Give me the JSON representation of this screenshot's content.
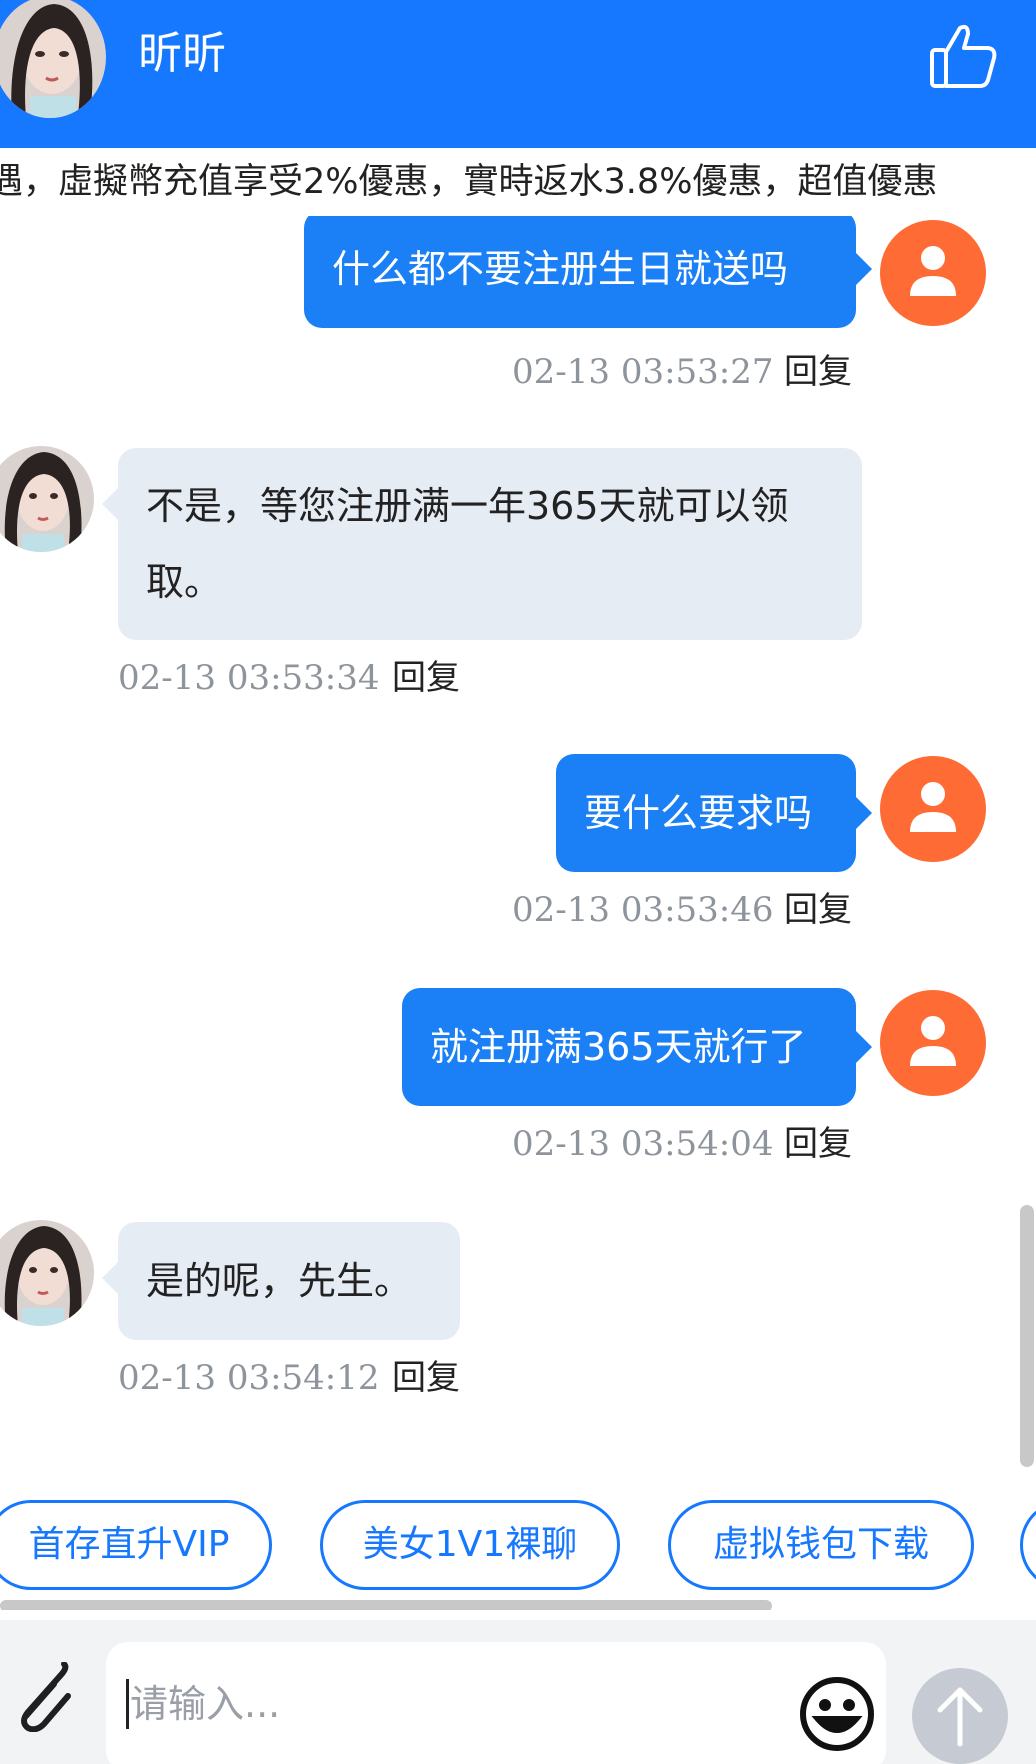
{
  "header": {
    "title": "昕昕"
  },
  "marquee": {
    "text": "遇，虛擬幣充值享受2%優惠，實時返水3.8%優惠，超值優惠"
  },
  "messages": [
    {
      "sender": "user",
      "text": "什么都不要注册生日就送吗",
      "time": "02-13 03:53:27",
      "reply": "回复"
    },
    {
      "sender": "agent",
      "text": "不是，等您注册满一年365天就可以领取。",
      "time": "02-13 03:53:34",
      "reply": "回复"
    },
    {
      "sender": "user",
      "text": "要什么要求吗",
      "time": "02-13 03:53:46",
      "reply": "回复"
    },
    {
      "sender": "user",
      "text": "就注册满365天就行了",
      "time": "02-13 03:54:04",
      "reply": "回复"
    },
    {
      "sender": "agent",
      "text": "是的呢，先生。",
      "time": "02-13 03:54:12",
      "reply": "回复"
    }
  ],
  "quick_buttons": [
    "首存直升VIP",
    "美女1V1裸聊",
    "虚拟钱包下载"
  ],
  "input": {
    "placeholder": "请输入..."
  },
  "colors": {
    "brand": "#1677ff",
    "user_bubble": "#1b80f5",
    "agent_bubble": "#e6ecf4",
    "user_avatar": "#ff6b35"
  },
  "icons": {
    "like": "thumbs-up-icon",
    "attach": "paperclip-icon",
    "emoji": "smiley-icon",
    "send": "arrow-up-icon",
    "user": "user-icon"
  }
}
